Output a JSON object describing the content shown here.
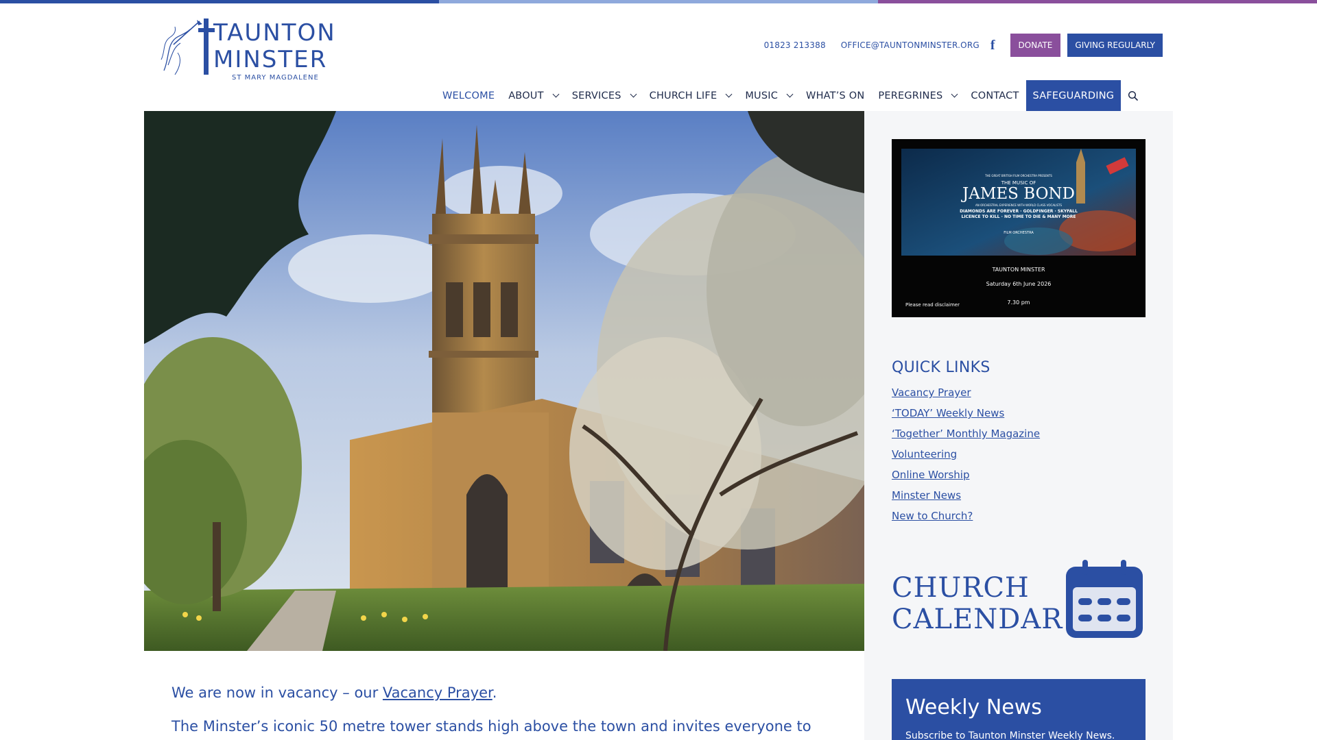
{
  "colors": {
    "brand_blue": "#2b4fa3",
    "purple": "#8a4f9c",
    "stripe": [
      "#2b4fa3",
      "#8fa9dc",
      "#8a4f9c"
    ]
  },
  "logo": {
    "line1": "TAUNTON",
    "line2": "MINSTER",
    "subtitle": "ST MARY MAGDALENE"
  },
  "contact": {
    "phone": "01823 213388",
    "email": "OFFICE@TAUNTONMINSTER.ORG",
    "facebook_icon": "f",
    "donate_label": "DONATE",
    "giving_label": "GIVING REGULARLY"
  },
  "nav": {
    "items": [
      {
        "label": "WELCOME",
        "dropdown": false
      },
      {
        "label": "ABOUT",
        "dropdown": true
      },
      {
        "label": "SERVICES",
        "dropdown": true
      },
      {
        "label": "CHURCH LIFE",
        "dropdown": true
      },
      {
        "label": "MUSIC",
        "dropdown": true
      },
      {
        "label": "WHAT’S ON",
        "dropdown": false
      },
      {
        "label": "PEREGRINES",
        "dropdown": true
      },
      {
        "label": "CONTACT",
        "dropdown": false
      },
      {
        "label": "SAFEGUARDING",
        "dropdown": false
      }
    ],
    "search_icon": "search-icon"
  },
  "intro": {
    "line1_prefix": "We are now in vacancy – our ",
    "line1_link": "Vacancy Prayer",
    "line1_suffix": ".",
    "line2": "The Minster’s iconic 50 metre tower stands high above the town and invites everyone to"
  },
  "poster": {
    "small_header": "THE GREAT BRITISH FILM ORCHESTRA PRESENTS",
    "music_of": "THE MUSIC OF",
    "title": "JAMES BOND",
    "tagline": "AN ORCHESTRAL EXPERIENCE WITH WORLD CLASS VOCALISTS",
    "songs1": "DIAMONDS ARE FOREVER · GOLDFINGER · SKYFALL",
    "songs2": "LICENCE TO KILL · NO TIME TO DIE & MANY MORE",
    "orchestra": "FILM ORCHESTRA",
    "venue": "TAUNTON MINSTER",
    "date": "Saturday 6th June 2026",
    "time": "7.30 pm",
    "disclaimer": "Please read disclaimer"
  },
  "quick_links": {
    "title": "QUICK LINKS",
    "items": [
      "Vacancy Prayer",
      "‘TODAY’ Weekly News",
      "‘Together’ Monthly Magazine",
      "Volunteering",
      "Online Worship",
      "Minster News",
      "New to Church?"
    ]
  },
  "calendar": {
    "line1": "CHURCH",
    "line2": "CALENDAR",
    "icon": "calendar-icon"
  },
  "weekly_news": {
    "title": "Weekly News",
    "text": "Subscribe to Taunton Minster Weekly News."
  }
}
